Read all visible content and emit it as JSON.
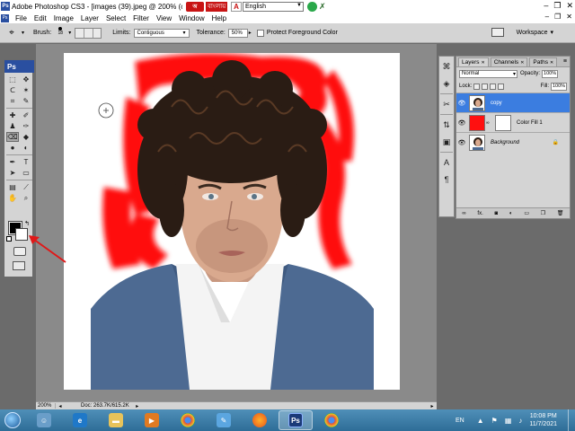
{
  "titlebar": {
    "title": "Adobe Photoshop CS3 - [images (39).jpeg @ 200% (co",
    "ime_bangla_text": "বাংলায়",
    "ime_language": "English"
  },
  "menubar": {
    "items": [
      "File",
      "Edit",
      "Image",
      "Layer",
      "Select",
      "Filter",
      "View",
      "Window",
      "Help"
    ]
  },
  "options": {
    "brush_label": "Brush:",
    "brush_size": "18",
    "limits_label": "Limits:",
    "limits_value": "Contiguous",
    "tolerance_label": "Tolerance:",
    "tolerance_value": "50%",
    "protect_fg_label": "Protect Foreground Color",
    "workspace_label": "Workspace"
  },
  "toolbox": {
    "badge": "Ps"
  },
  "statusbar": {
    "zoom": "200%",
    "doc": "Doc: 263.7K/615.2K"
  },
  "layers_panel": {
    "tabs": [
      "Layers",
      "Channels",
      "Paths"
    ],
    "blend_mode": "Normal",
    "opacity_label": "Opacity:",
    "opacity_value": "100%",
    "lock_label": "Lock:",
    "fill_label": "Fill:",
    "fill_value": "100%",
    "layers": [
      {
        "name": "copy",
        "selected": true
      },
      {
        "name": "Color Fill 1",
        "selected": false
      },
      {
        "name": "Background",
        "selected": false
      }
    ],
    "footer_fx": "fx."
  },
  "taskbar": {
    "lang": "EN",
    "time": "10:08 PM",
    "date": "11/7/2021",
    "ps_label": "Ps"
  },
  "colors": {
    "accent_layer_selected": "#3b7de0",
    "color_fill": "#ff1010",
    "photoshop_blue": "#2a4fa0",
    "annotation_arrow": "#e01818",
    "foreground_color": "#000000",
    "background_color": "#ffffff"
  }
}
